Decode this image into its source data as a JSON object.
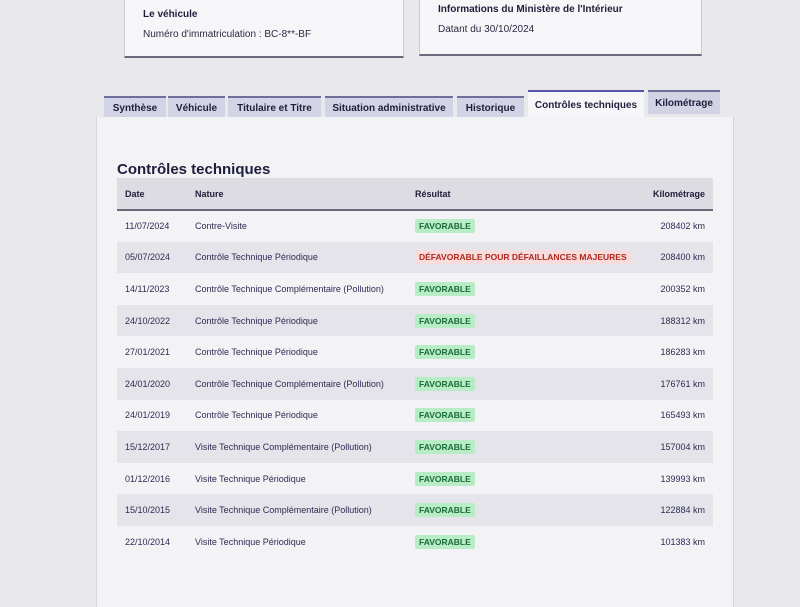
{
  "vehicle_card": {
    "title": "Le véhicule",
    "plate_label": "Numéro d'immatriculation : BC-8**-BF"
  },
  "ministry_card": {
    "title": "Informations du Ministère de l'Intérieur",
    "date_label": "Datant du 30/10/2024"
  },
  "tabs": [
    {
      "label": "Synthèse"
    },
    {
      "label": "Véhicule"
    },
    {
      "label": "Titulaire et Titre"
    },
    {
      "label": "Situation administrative"
    },
    {
      "label": "Historique"
    },
    {
      "label": "Contrôles techniques",
      "active": true
    },
    {
      "label": "Kilométrage"
    }
  ],
  "section": {
    "title": "Contrôles techniques",
    "columns": {
      "date": "Date",
      "nature": "Nature",
      "result": "Résultat",
      "km": "Kilométrage"
    }
  },
  "rows": [
    {
      "date": "11/07/2024",
      "nature": "Contre-Visite",
      "result": "FAVORABLE",
      "km": "208402 km"
    },
    {
      "date": "05/07/2024",
      "nature": "Contrôle Technique Périodique",
      "result": "DÉFAVORABLE POUR DÉFAILLANCES MAJEURES",
      "km": "208400 km"
    },
    {
      "date": "14/11/2023",
      "nature": "Contrôle Technique Complémentaire (Pollution)",
      "result": "FAVORABLE",
      "km": "200352 km"
    },
    {
      "date": "24/10/2022",
      "nature": "Contrôle Technique Périodique",
      "result": "FAVORABLE",
      "km": "188312 km"
    },
    {
      "date": "27/01/2021",
      "nature": "Contrôle Technique Périodique",
      "result": "FAVORABLE",
      "km": "186283 km"
    },
    {
      "date": "24/01/2020",
      "nature": "Contrôle Technique Complémentaire (Pollution)",
      "result": "FAVORABLE",
      "km": "176761 km"
    },
    {
      "date": "24/01/2019",
      "nature": "Contrôle Technique Périodique",
      "result": "FAVORABLE",
      "km": "165493 km"
    },
    {
      "date": "15/12/2017",
      "nature": "Visite Technique Complémentaire (Pollution)",
      "result": "FAVORABLE",
      "km": "157004 km"
    },
    {
      "date": "01/12/2016",
      "nature": "Visite Technique Périodique",
      "result": "FAVORABLE",
      "km": "139993 km"
    },
    {
      "date": "15/10/2015",
      "nature": "Visite Technique Complémentaire (Pollution)",
      "result": "FAVORABLE",
      "km": "122884 km"
    },
    {
      "date": "22/10/2014",
      "nature": "Visite Technique Périodique",
      "result": "FAVORABLE",
      "km": "101383 km"
    }
  ],
  "colors": {
    "favorable_bg": "#b8ecc6",
    "favorable_text": "#1b6d36",
    "unfavorable_text": "#b0281e",
    "tab_accent": "#5555aa"
  }
}
